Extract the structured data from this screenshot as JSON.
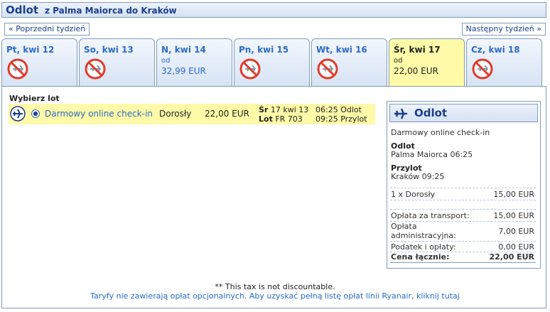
{
  "header": {
    "title": "Odlot",
    "route": "z Palma Maiorca do Kraków"
  },
  "nav": {
    "prev_label": "« Poprzedni tydzień",
    "next_label": "Następny tydzień »"
  },
  "days": [
    {
      "label": "Pt, kwi 12",
      "available": false
    },
    {
      "label": "So, kwi 13",
      "available": false
    },
    {
      "label": "N, kwi 14",
      "available": true,
      "od": "od",
      "price": "32,99 EUR"
    },
    {
      "label": "Pn, kwi 15",
      "available": false
    },
    {
      "label": "Wt, kwi 16",
      "available": false
    },
    {
      "label": "Śr, kwi 17",
      "available": true,
      "selected": true,
      "od": "od",
      "price": "22,00 EUR"
    },
    {
      "label": "Cz, kwi 18",
      "available": false
    }
  ],
  "icons": {
    "no_flight": "no-flight-icon",
    "plane": "plane-icon"
  },
  "colors": {
    "accent": "#1b3f8b",
    "link": "#2a6bc9",
    "selected_bg": "#fffaa8",
    "no_flight_red": "#e03c2c"
  },
  "flight": {
    "section_title": "Wybierz lot",
    "fare_name": "Darmowy online check-in",
    "pax_type": "Dorosły",
    "price": "22,00 EUR",
    "day_prefix": "Śr",
    "day_date": "17 kwi 13",
    "flight_prefix": "Lot",
    "flight_number": "FR 703",
    "departure": "06:25 Odlot",
    "arrival": "09:25 Przylot"
  },
  "summary": {
    "title": "Odlot",
    "fare_name": "Darmowy online check-in",
    "dep_heading": "Odlot",
    "dep_value": "Palma Maiorca 06:25",
    "arr_heading": "Przylot",
    "arr_value": "Kraków 09:25",
    "pax_label": "1 x Dorosły",
    "pax_price": "15,00 EUR",
    "transport_label": "Opłata za transport:",
    "transport_value": "15,00 EUR",
    "admin_label_1": "Opłata",
    "admin_label_2": "administracyjna:",
    "admin_value": "7,00 EUR",
    "tax_label": "Podatek i opłaty:",
    "tax_value": "0,00 EUR",
    "total_label": "Cena łącznie:",
    "total_value": "22,00 EUR"
  },
  "footer": {
    "note": "** This tax is not discountable.",
    "link": "Taryfy nie zawierają opłat opcjonalnych. Aby uzyskać pełną listę opłat linii Ryanair, kliknij tutaj"
  }
}
